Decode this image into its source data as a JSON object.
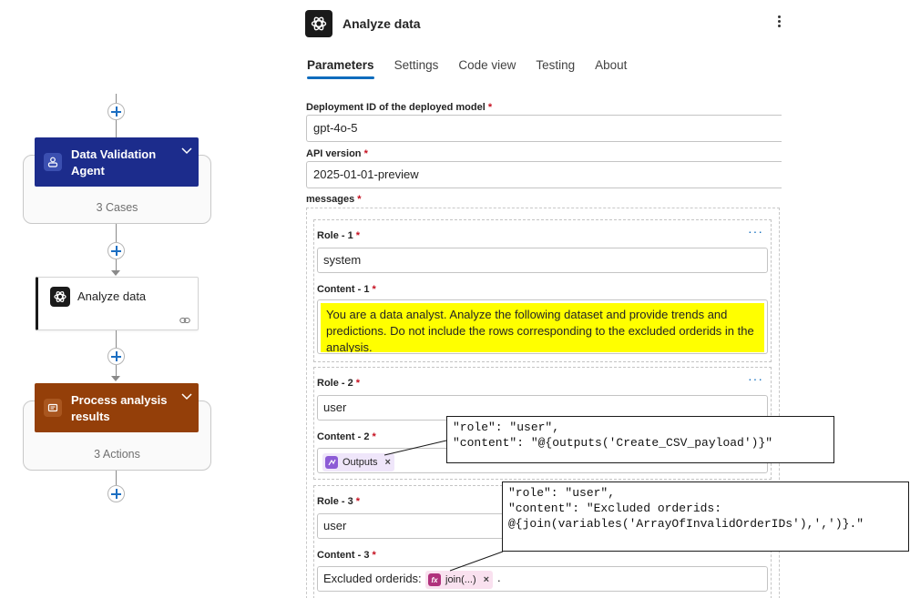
{
  "flow": {
    "group1": {
      "title": "Data Validation Agent",
      "count": "3 Cases"
    },
    "action": {
      "title": "Analyze data"
    },
    "group2": {
      "title": "Process analysis results",
      "count": "3 Actions"
    }
  },
  "pane": {
    "title": "Analyze data",
    "tabs": [
      "Parameters",
      "Settings",
      "Code view",
      "Testing",
      "About"
    ],
    "active_tab": "Parameters",
    "deployment": {
      "label": "Deployment ID of the deployed model",
      "value": "gpt-4o-5"
    },
    "api_version": {
      "label": "API version",
      "value": "2025-01-01-preview"
    },
    "messages_label": "messages",
    "required_mark": "*",
    "messages": [
      {
        "role_label": "Role - 1",
        "role": "system",
        "content_label": "Content - 1",
        "content": "You are a data analyst. Analyze the following dataset and provide trends and predictions. Do not include the rows corresponding to the excluded orderids in the analysis."
      },
      {
        "role_label": "Role - 2",
        "role": "user",
        "content_label": "Content - 2",
        "token": "Outputs"
      },
      {
        "role_label": "Role - 3",
        "role": "user",
        "content_label": "Content - 3",
        "prefix": "Excluded orderids:",
        "token": "join(...)",
        "suffix": "."
      }
    ],
    "more": "···",
    "remove": "×"
  },
  "callouts": [
    {
      "line1": "\"role\": \"user\",",
      "line2": "\"content\": \"@{outputs('Create_CSV_payload')}\""
    },
    {
      "line1": "\"role\": \"user\",",
      "line2": "\"content\": \"Excluded orderids:",
      "line3": "@{join(variables('ArrayOfInvalidOrderIDs'),',')}.\""
    }
  ],
  "colors": {
    "accent": "#0f6cbd",
    "agent": "#1c2c8c",
    "scope": "#943f09",
    "highlight": "#ffff00"
  }
}
